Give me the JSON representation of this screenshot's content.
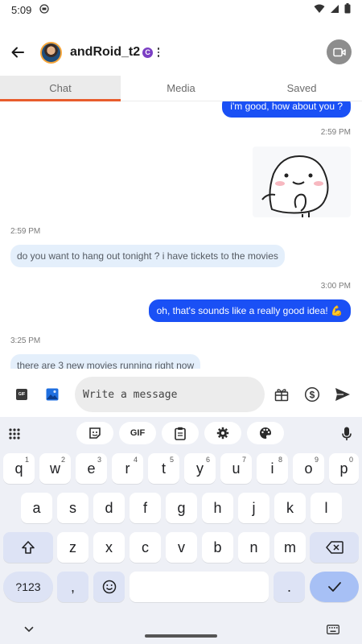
{
  "status_bar": {
    "time": "5:09"
  },
  "header": {
    "username": "andRoid_t2",
    "badge_letter": "C"
  },
  "tabs": [
    {
      "label": "Chat",
      "active": true
    },
    {
      "label": "Media",
      "active": false
    },
    {
      "label": "Saved",
      "active": false
    }
  ],
  "messages": {
    "m1_text": "i'm good, how about you ?",
    "ts1": "2:59 PM",
    "ts2": "2:59 PM",
    "m2_text": "do you want to hang out tonight ? i have tickets to the movies",
    "ts3": "3:00 PM",
    "m3_text": "oh, that's sounds like a really good idea! 💪",
    "ts4": "3:25 PM",
    "m4_text": "there are 3 new movies running right now"
  },
  "composer": {
    "placeholder": "Write a message"
  },
  "keyboard": {
    "gif_label": "GIF",
    "row1": [
      "q",
      "w",
      "e",
      "r",
      "t",
      "y",
      "u",
      "i",
      "o",
      "p"
    ],
    "row1_hints": [
      "1",
      "2",
      "3",
      "4",
      "5",
      "6",
      "7",
      "8",
      "9",
      "0"
    ],
    "row2": [
      "a",
      "s",
      "d",
      "f",
      "g",
      "h",
      "j",
      "k",
      "l"
    ],
    "row3": [
      "z",
      "x",
      "c",
      "v",
      "b",
      "n",
      "m"
    ],
    "symbols_label": "?123",
    "comma": ",",
    "period": "."
  },
  "colors": {
    "accent_tab": "#e85c2c",
    "outgoing_bubble": "#1a50f5",
    "incoming_bubble": "#e4effb",
    "badge": "#7b3fc4"
  },
  "icons": [
    "wifi-icon",
    "cell-signal-icon",
    "battery-icon",
    "back-arrow-icon",
    "video-call-icon",
    "gif-icon",
    "image-icon",
    "gift-icon",
    "dollar-icon",
    "send-icon",
    "apps-grid-icon",
    "sticker-icon",
    "clipboard-icon",
    "settings-icon",
    "palette-icon",
    "mic-icon",
    "shift-icon",
    "backspace-icon",
    "emoji-icon",
    "checkmark-icon",
    "chevron-down-icon",
    "keyboard-icon"
  ]
}
